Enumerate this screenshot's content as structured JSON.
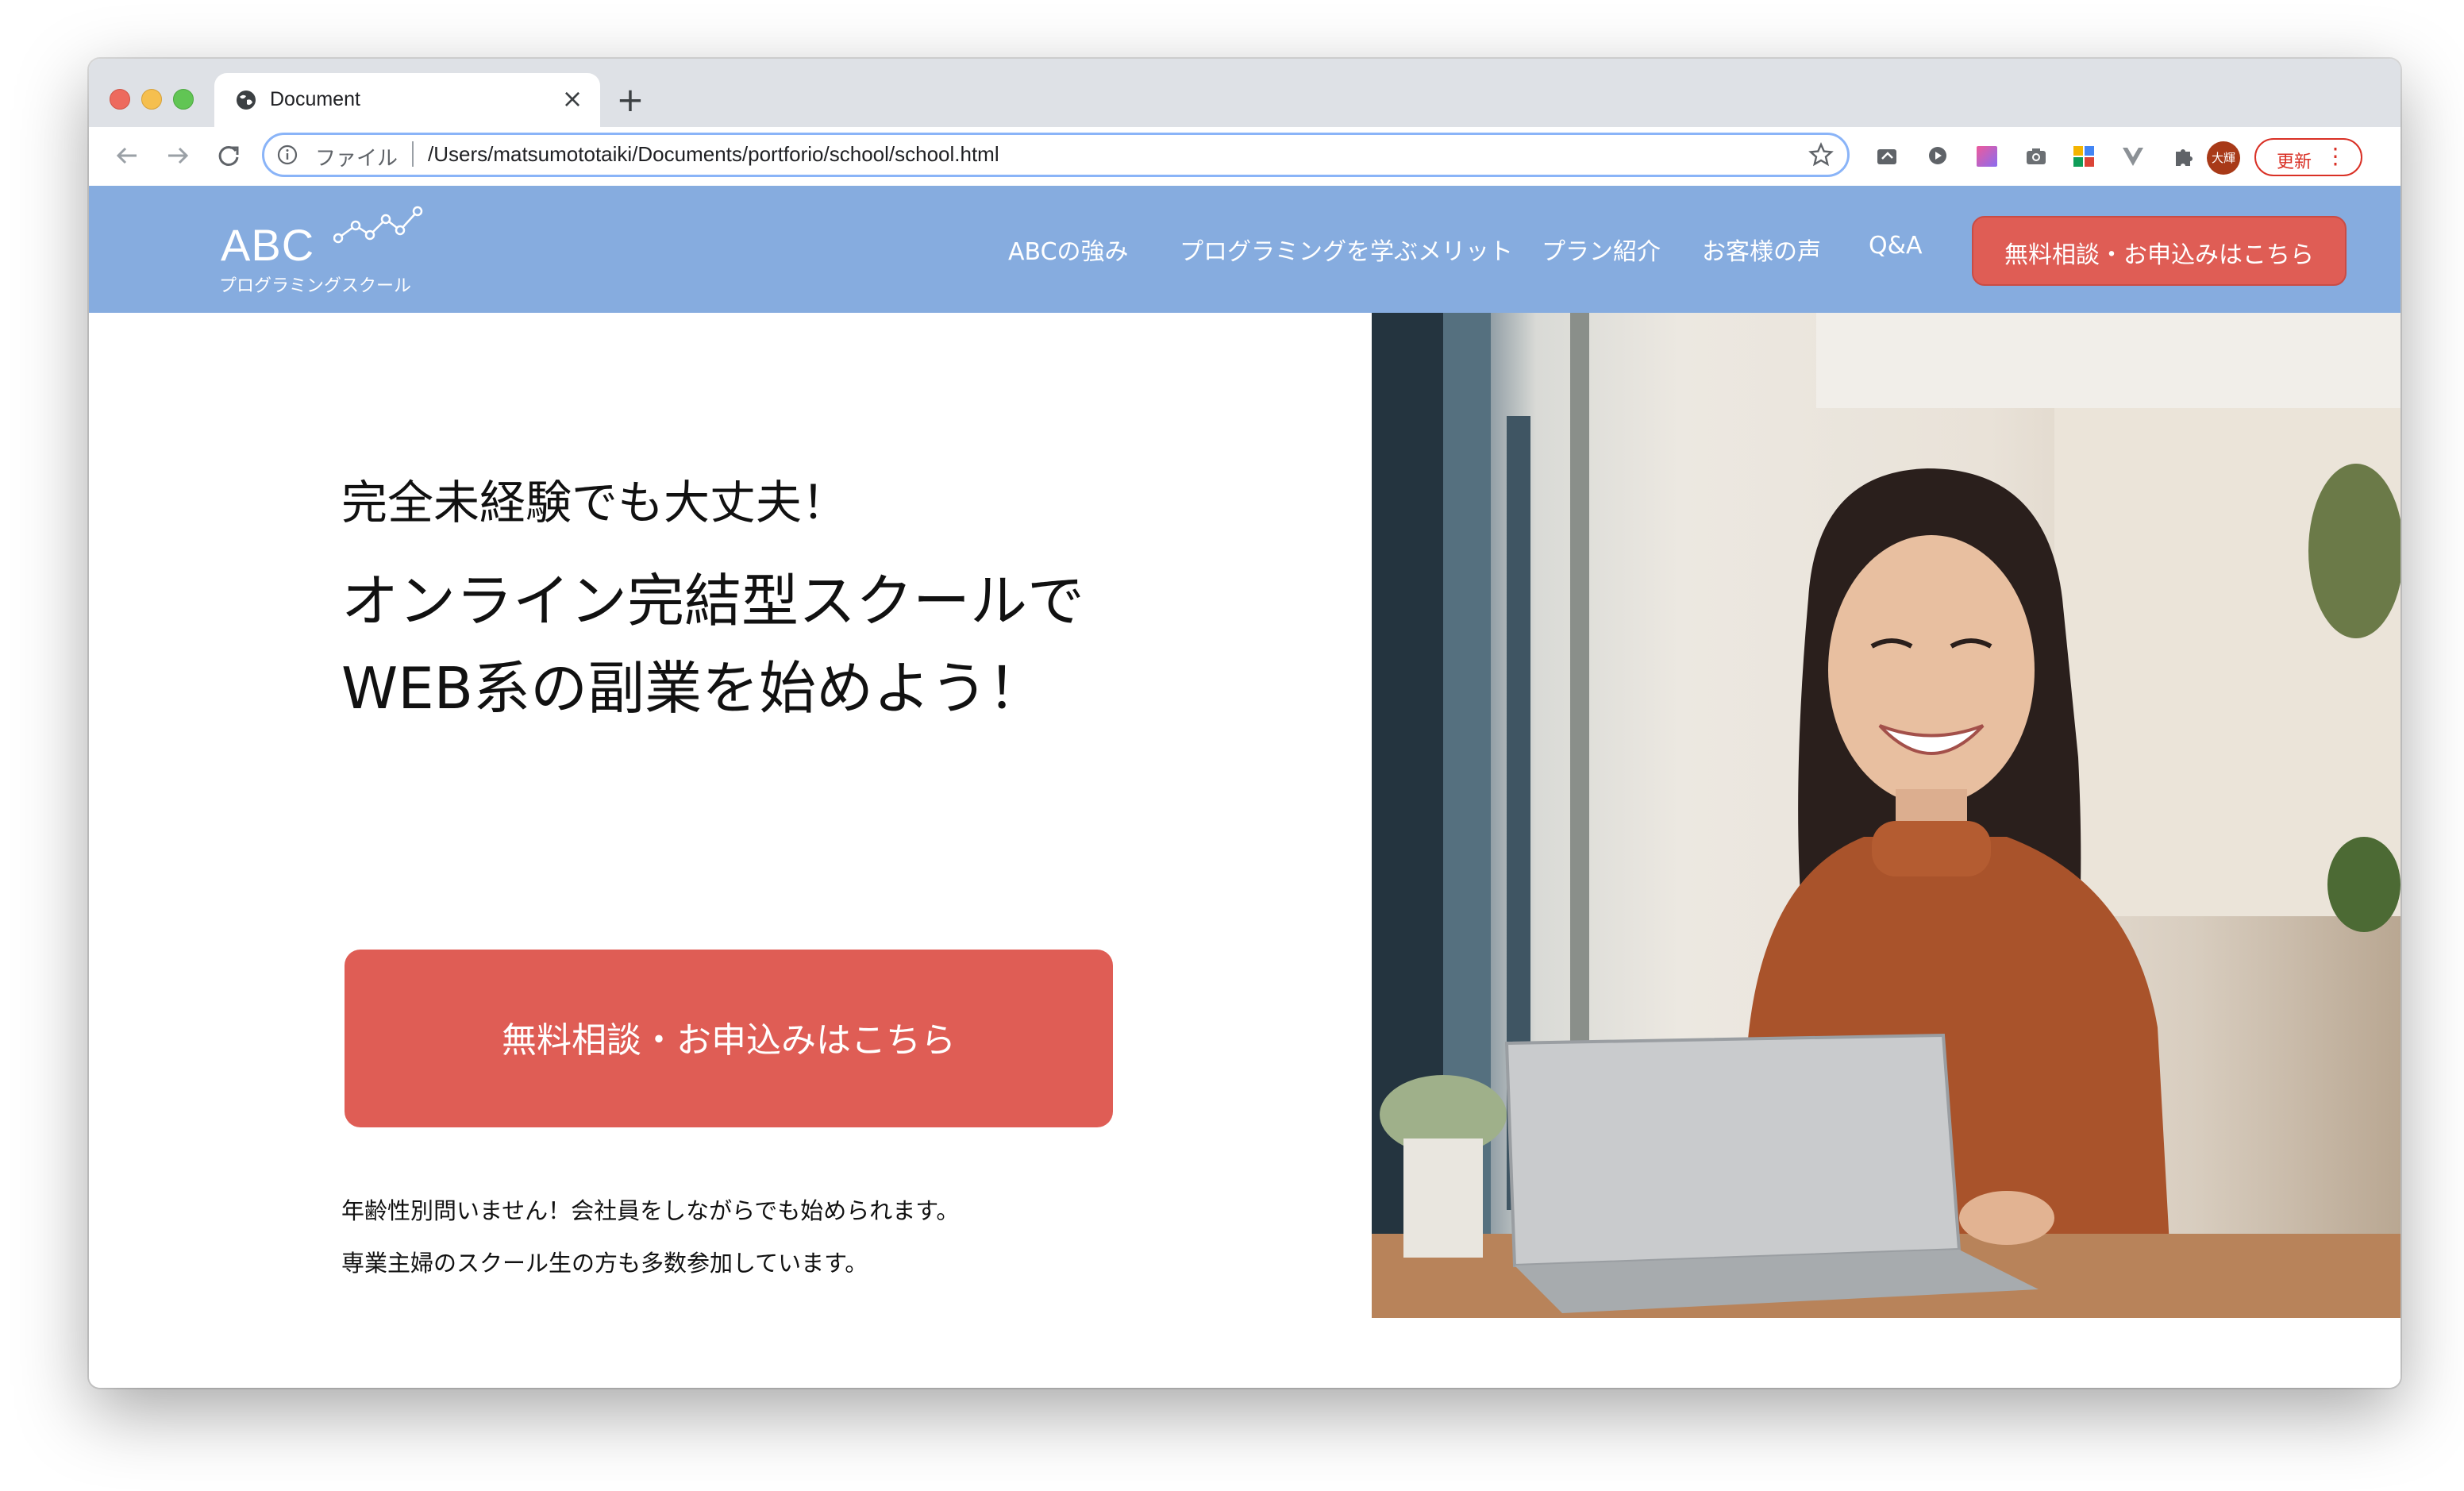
{
  "browser": {
    "tab_title": "Document",
    "new_tab_label": "+",
    "close_label": "×",
    "url_scheme_label": "ファイル",
    "url": "/Users/matsumototaiki/Documents/portforio/school/school.html",
    "profile_label": "大輝",
    "update_label": "更新",
    "menu_label": "⋮",
    "icons": [
      "back-icon",
      "forward-icon",
      "reload-icon",
      "info-icon",
      "star-icon",
      "extension-icon",
      "puzzle-icon"
    ]
  },
  "site": {
    "logo_text": "ABC",
    "logo_sub": "プログラミングスクール",
    "nav": [
      "ABCの強み",
      "プログラミングを学ぶメリット",
      "プラン紹介",
      "お客様の声",
      "Q&A"
    ],
    "header_cta": "無料相談・お申込みはこちら"
  },
  "hero": {
    "lead": "完全未経験でも大丈夫！",
    "title_line1": "オンライン完結型スクールで",
    "title_line2": "WEB系の副業を始めよう！",
    "cta": "無料相談・お申込みはこちら",
    "note_line1": "年齢性別問いません！会社員をしながらでも始められます。",
    "note_line2": "専業主婦のスクール生の方も多数参加しています。"
  },
  "colors": {
    "header_bg": "#86acdf",
    "cta_bg": "#df5d55"
  }
}
